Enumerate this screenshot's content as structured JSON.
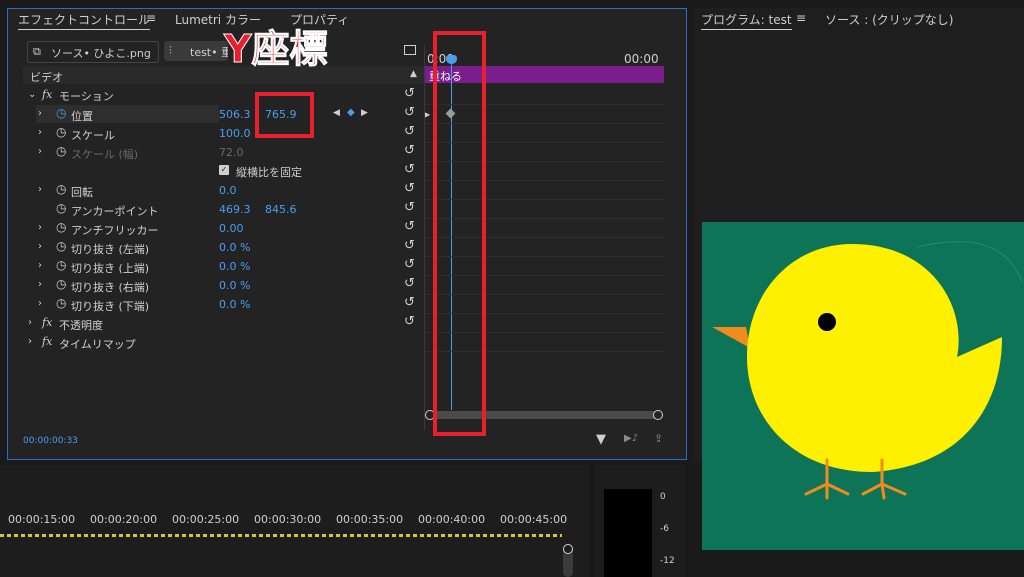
{
  "tabs": {
    "effect_controls": "エフェクトコントロール",
    "lumetri": "Lumetri カラー",
    "properties": "プロパティ",
    "menu_icon": "≡"
  },
  "clip_tabs": {
    "source": "ソース• ひよこ.png",
    "sequence": "test• 重"
  },
  "section_video": "ビデオ",
  "timeruler": {
    "t0": "0:00",
    "t1": "00:00"
  },
  "clip_bar_label": "重ねる",
  "annotation": "Y座標",
  "rows": {
    "motion": "モーション",
    "position": {
      "label": "位置",
      "x": "506.3",
      "y": "765.9"
    },
    "scale": {
      "label": "スケール",
      "v": "100.0"
    },
    "scale_w": {
      "label": "スケール (幅)",
      "v": "72.0"
    },
    "uniform": "縦横比を固定",
    "rotation": {
      "label": "回転",
      "v": "0.0"
    },
    "anchor": {
      "label": "アンカーポイント",
      "x": "469.3",
      "y": "845.6"
    },
    "flicker": {
      "label": "アンチフリッカー",
      "v": "0.00"
    },
    "crop_l": {
      "label": "切り抜き (左端)",
      "v": "0.0 %"
    },
    "crop_t": {
      "label": "切り抜き (上端)",
      "v": "0.0 %"
    },
    "crop_r": {
      "label": "切り抜き (右端)",
      "v": "0.0 %"
    },
    "crop_b": {
      "label": "切り抜き (下端)",
      "v": "0.0 %"
    },
    "opacity": "不透明度",
    "timeremap": "タイムリマップ"
  },
  "timecode": "00:00:00:33",
  "program": {
    "tab": "プログラム: test",
    "source": "ソース : (クリップなし)"
  },
  "timeline_ticks": [
    "00:00:15:00",
    "00:00:20:00",
    "00:00:25:00",
    "00:00:30:00",
    "00:00:35:00",
    "00:00:40:00",
    "00:00:45:00"
  ],
  "meter_ticks": [
    "0",
    "-6",
    "-12"
  ],
  "colors": {
    "accent": "#4a9ef0",
    "clip": "#7b1e8c",
    "annotation": "#e8202d",
    "preview_bg": "#0e7458",
    "chick": "#ffef00",
    "beak": "#f08c1e"
  }
}
